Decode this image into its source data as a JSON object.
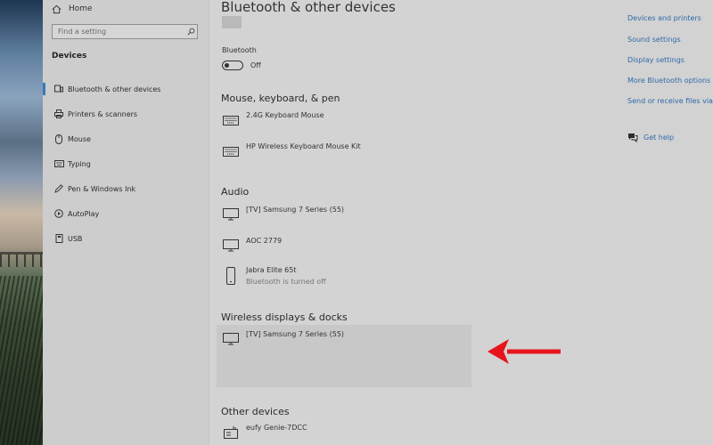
{
  "nav": {
    "home_label": "Home",
    "search_placeholder": "Find a setting",
    "section_title": "Devices",
    "items": [
      {
        "label": "Bluetooth & other devices",
        "icon": "bluetooth-devices-icon",
        "active": true
      },
      {
        "label": "Printers & scanners",
        "icon": "printer-icon"
      },
      {
        "label": "Mouse",
        "icon": "mouse-icon"
      },
      {
        "label": "Typing",
        "icon": "keyboard-icon"
      },
      {
        "label": "Pen & Windows Ink",
        "icon": "pen-icon"
      },
      {
        "label": "AutoPlay",
        "icon": "autoplay-icon"
      },
      {
        "label": "USB",
        "icon": "usb-icon"
      }
    ]
  },
  "main": {
    "title": "Bluetooth & other devices",
    "bluetooth": {
      "label": "Bluetooth",
      "state": "Off"
    },
    "groups": {
      "mouse_keyboard_pen": {
        "title": "Mouse, keyboard, & pen",
        "devices": [
          {
            "name": "2.4G Keyboard Mouse",
            "icon": "keyboard-icon"
          },
          {
            "name": "HP Wireless Keyboard Mouse Kit",
            "icon": "keyboard-icon"
          }
        ]
      },
      "audio": {
        "title": "Audio",
        "devices": [
          {
            "name": "[TV] Samsung 7 Series (55)",
            "icon": "monitor-icon"
          },
          {
            "name": "AOC 2779",
            "icon": "monitor-icon"
          },
          {
            "name": "Jabra Elite 65t",
            "status": "Bluetooth is turned off",
            "icon": "phone-icon"
          }
        ]
      },
      "wireless_displays": {
        "title": "Wireless displays & docks",
        "devices": [
          {
            "name": "[TV] Samsung 7 Series (55)",
            "icon": "monitor-icon"
          }
        ]
      },
      "other": {
        "title": "Other devices",
        "devices": [
          {
            "name": "eufy Genie-7DCC",
            "icon": "router-icon"
          }
        ]
      }
    }
  },
  "related": {
    "links": [
      "Devices and printers",
      "Sound settings",
      "Display settings",
      "More Bluetooth options",
      "Send or receive files via B"
    ],
    "help": "Get help"
  },
  "annotation": {
    "arrow_color": "#e8141c"
  },
  "colors": {
    "link": "#2f6aa8",
    "accent": "#3a78b8"
  }
}
